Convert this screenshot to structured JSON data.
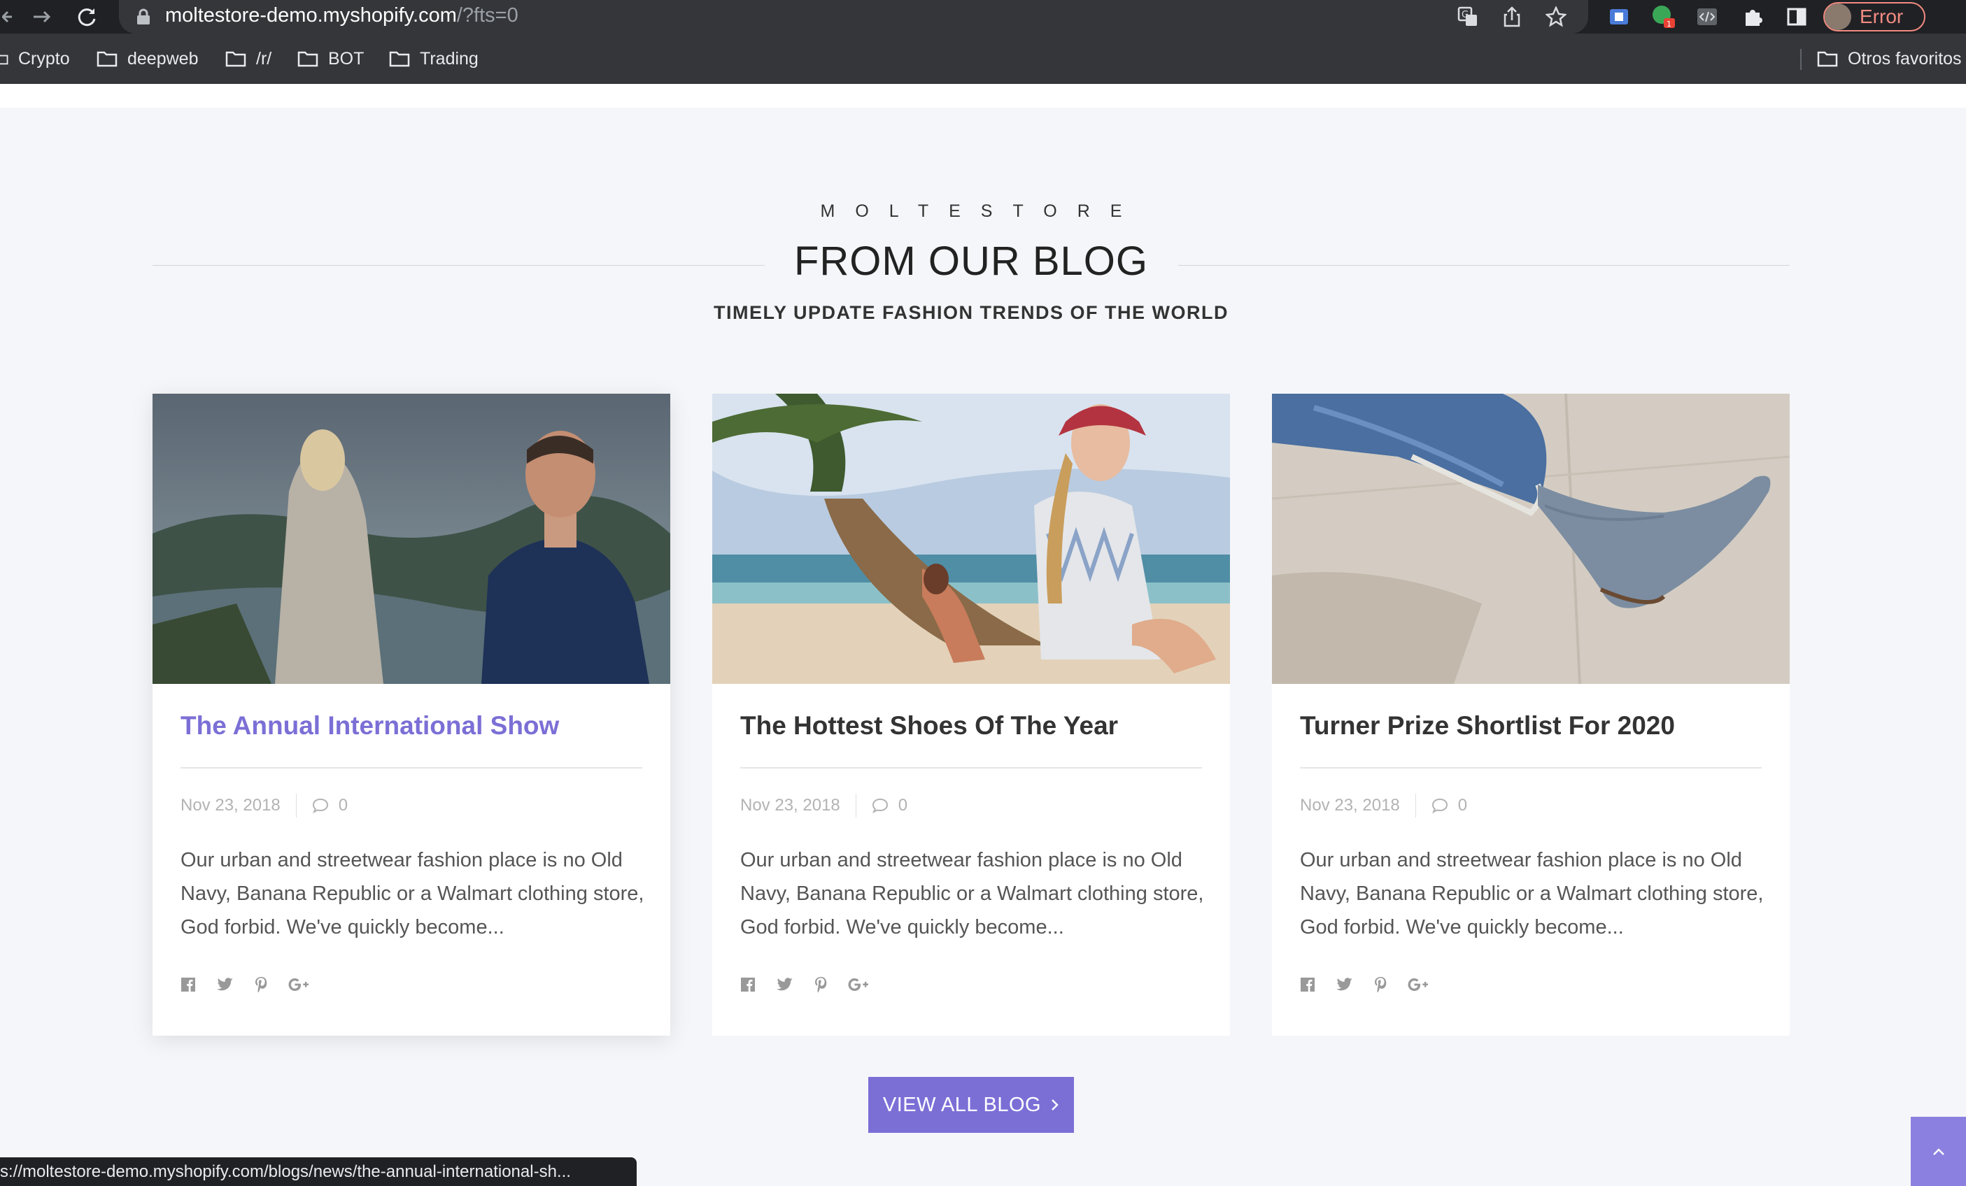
{
  "browser": {
    "url_host": "moltestore-demo.myshopify.com",
    "url_path": "/?fts=0",
    "profile_label": "Error",
    "ext_badge": "1",
    "bookmarks": [
      "Crypto",
      "deepweb",
      "/r/",
      "BOT",
      "Trading"
    ],
    "other_bookmarks": "Otros favoritos",
    "status_url": "s://moltestore-demo.myshopify.com/blogs/news/the-annual-international-sh..."
  },
  "section": {
    "eyebrow": "MOLTESTORE",
    "title": "FROM OUR BLOG",
    "subtitle": "TIMELY UPDATE FASHION TRENDS OF THE WORLD"
  },
  "posts": [
    {
      "title": "The Annual International Show",
      "date": "Nov 23, 2018",
      "comments": "0",
      "excerpt": "Our urban and streetwear fashion place is no Old Navy, Banana Republic or a Walmart clothing store, God forbid. We've quickly become..."
    },
    {
      "title": "The Hottest Shoes Of The Year",
      "date": "Nov 23, 2018",
      "comments": "0",
      "excerpt": "Our urban and streetwear fashion place is no Old Navy, Banana Republic or a Walmart clothing store, God forbid. We've quickly become..."
    },
    {
      "title": "Turner Prize Shortlist For 2020",
      "date": "Nov 23, 2018",
      "comments": "0",
      "excerpt": "Our urban and streetwear fashion place is no Old Navy, Banana Republic or a Walmart clothing store, God forbid. We've quickly become..."
    }
  ],
  "view_all_label": "VIEW ALL BLOG",
  "colors": {
    "accent": "#7b6fd6",
    "page_bg": "#f5f6f9",
    "chrome_bg": "#202124"
  },
  "icons": [
    "back-icon",
    "forward-icon",
    "reload-icon",
    "lock-icon",
    "translate-icon",
    "share-icon",
    "star-icon",
    "puzzle-icon",
    "folder-icon",
    "comment-icon",
    "facebook-icon",
    "twitter-icon",
    "pinterest-icon",
    "google-plus-icon",
    "chevron-right-icon",
    "chevron-up-icon"
  ]
}
